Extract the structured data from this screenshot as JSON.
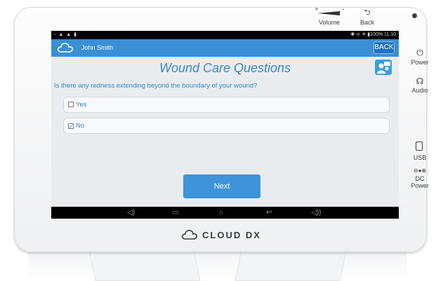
{
  "hardware": {
    "volume_label": "Volume",
    "volume_plus": "+",
    "volume_minus": "-",
    "back_label": "Back",
    "back_glyph": "⮌",
    "power_label": "Power",
    "audio_label": "Audio",
    "usb_label": "USB",
    "dc_power_label": "DC\nPower"
  },
  "statusbar": {
    "left_icons": "◦ ▲ ▲ ▮",
    "right_text": "✱ ᯤ ✈ ▮100% 11:10"
  },
  "appbar": {
    "user_name": "John Smith",
    "back_button": "BACK"
  },
  "screen": {
    "title": "Wound Care Questions",
    "question": "Is there any redness extending beyond the boundary of your wound?",
    "options": [
      {
        "label": "Yes",
        "checked": false
      },
      {
        "label": "No",
        "checked": true
      }
    ],
    "next_button": "Next"
  },
  "brand": {
    "name": "CLOUD DX"
  },
  "colors": {
    "accent": "#3a8fd5",
    "title_text": "#3a87c8",
    "content_bg": "#e9ecef"
  }
}
